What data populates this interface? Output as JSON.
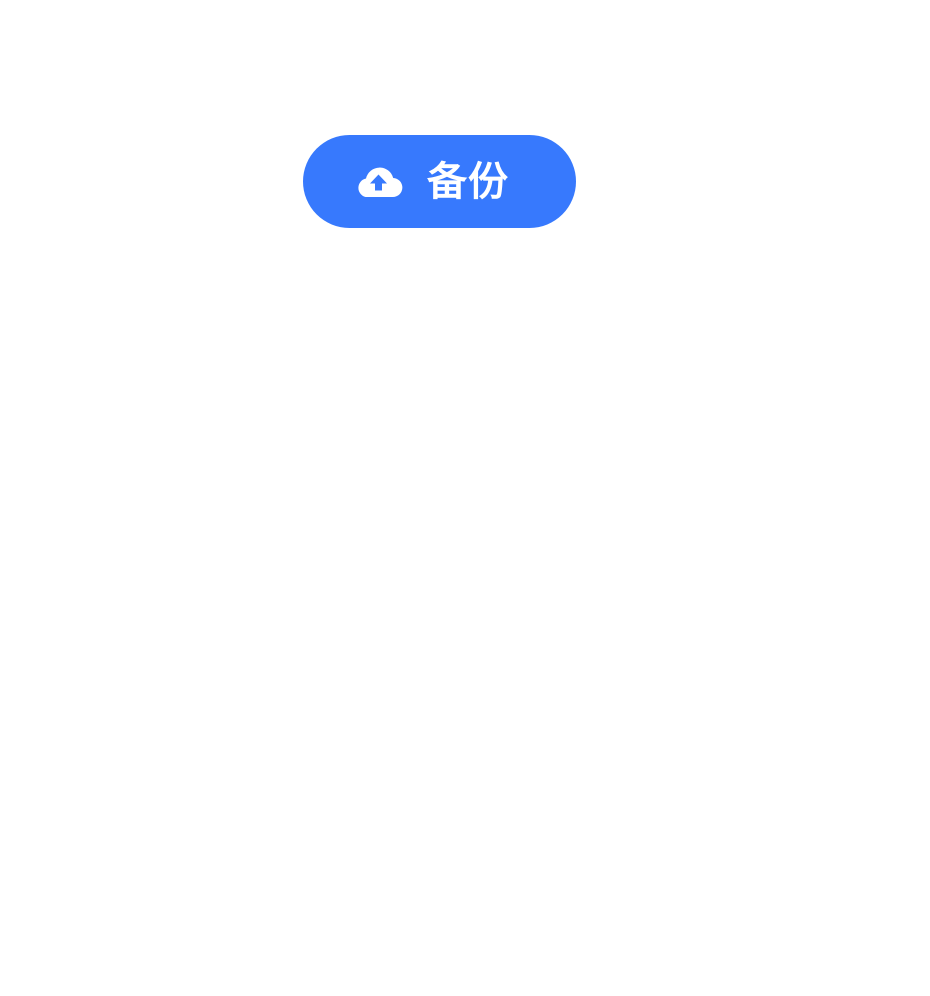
{
  "backup_button": {
    "label": "备份",
    "icon": "cloud-upload-icon",
    "background_color": "#3779FD",
    "text_color": "#FFFFFF"
  }
}
